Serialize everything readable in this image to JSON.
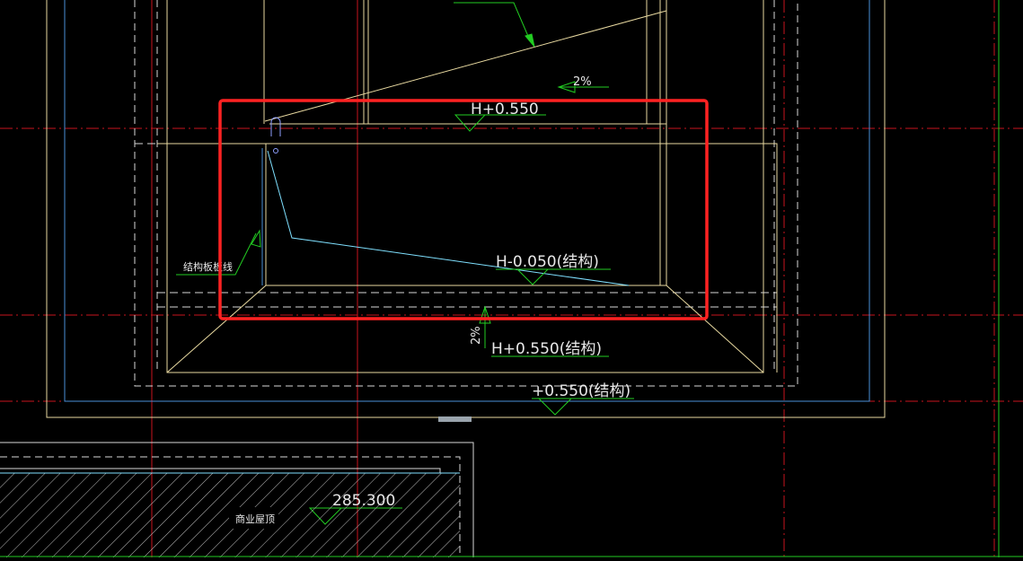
{
  "drawing": {
    "labels": {
      "top_elevation": "H+0.550",
      "inner_elevation": "H-0.050(结构)",
      "lower_elevation": "H+0.550(结构)",
      "outer_elevation": "+0.550(结构)",
      "slope_top": "2%",
      "slope_side": "2%",
      "struct_line": "结构板板线",
      "roof_elevation": "285.300",
      "roof_name": "商业屋顶"
    },
    "colors": {
      "background": "#000000",
      "axis_red": "#c8141e",
      "green": "#22cc22",
      "yellow": "#e8d9a0",
      "white_dashed": "#d8d8d8",
      "cyan": "#7fe0ff",
      "blue": "#4a8fd8",
      "highlight_box": "#ff2222"
    }
  }
}
